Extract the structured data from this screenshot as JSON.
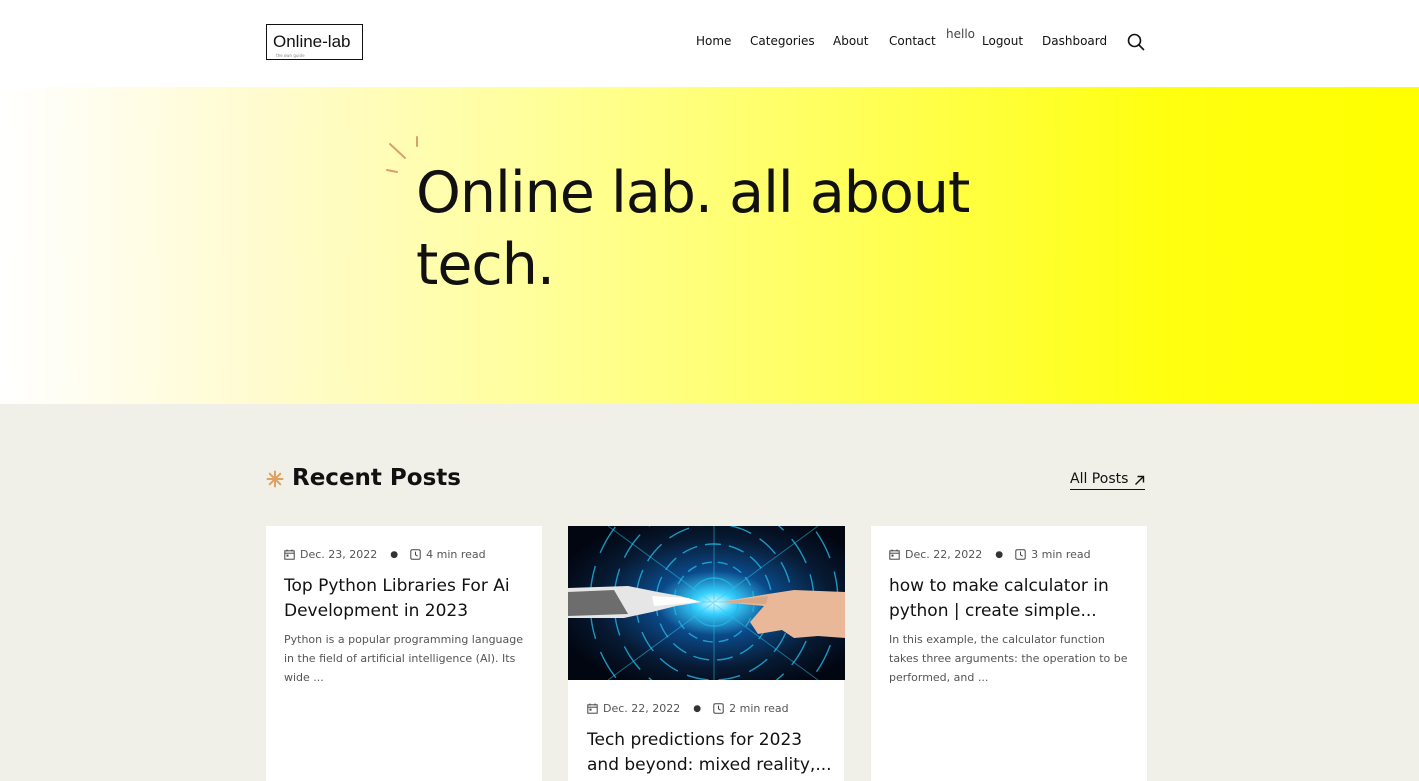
{
  "header": {
    "logo_text": "Online-lab",
    "logo_tagline": "the own guide",
    "nav": [
      {
        "label": "Home"
      },
      {
        "label": "Categories"
      },
      {
        "label": "About"
      },
      {
        "label": "Contact"
      },
      {
        "label": "Logout"
      },
      {
        "label": "Dashboard"
      }
    ],
    "greeting": "hello",
    "search_icon": "search-icon"
  },
  "hero": {
    "title": "Online lab. all about tech."
  },
  "recent": {
    "title": "Recent Posts",
    "all_posts_label": "All Posts",
    "posts": [
      {
        "date": "Dec. 23, 2022",
        "read_time": "4 min read",
        "title": "Top Python Libraries For Ai Development in 2023",
        "excerpt": "Python is a popular programming language in the field of artificial intelligence (AI). Its wide ..."
      },
      {
        "date": "Dec. 22, 2022",
        "read_time": "2 min read",
        "title": "Tech predictions for 2023 and beyond: mixed reality,...",
        "image": "robot-and-human-hands-touching"
      },
      {
        "date": "Dec. 22, 2022",
        "read_time": "3 min read",
        "title": "how to make calculator in python | create simple...",
        "excerpt": "In this example, the calculator function takes three arguments: the operation to be performed, and ..."
      }
    ]
  },
  "colors": {
    "hero_yellow": "#ffff00",
    "page_bg": "#f0f0e8",
    "accent_orange": "#e0a060"
  }
}
